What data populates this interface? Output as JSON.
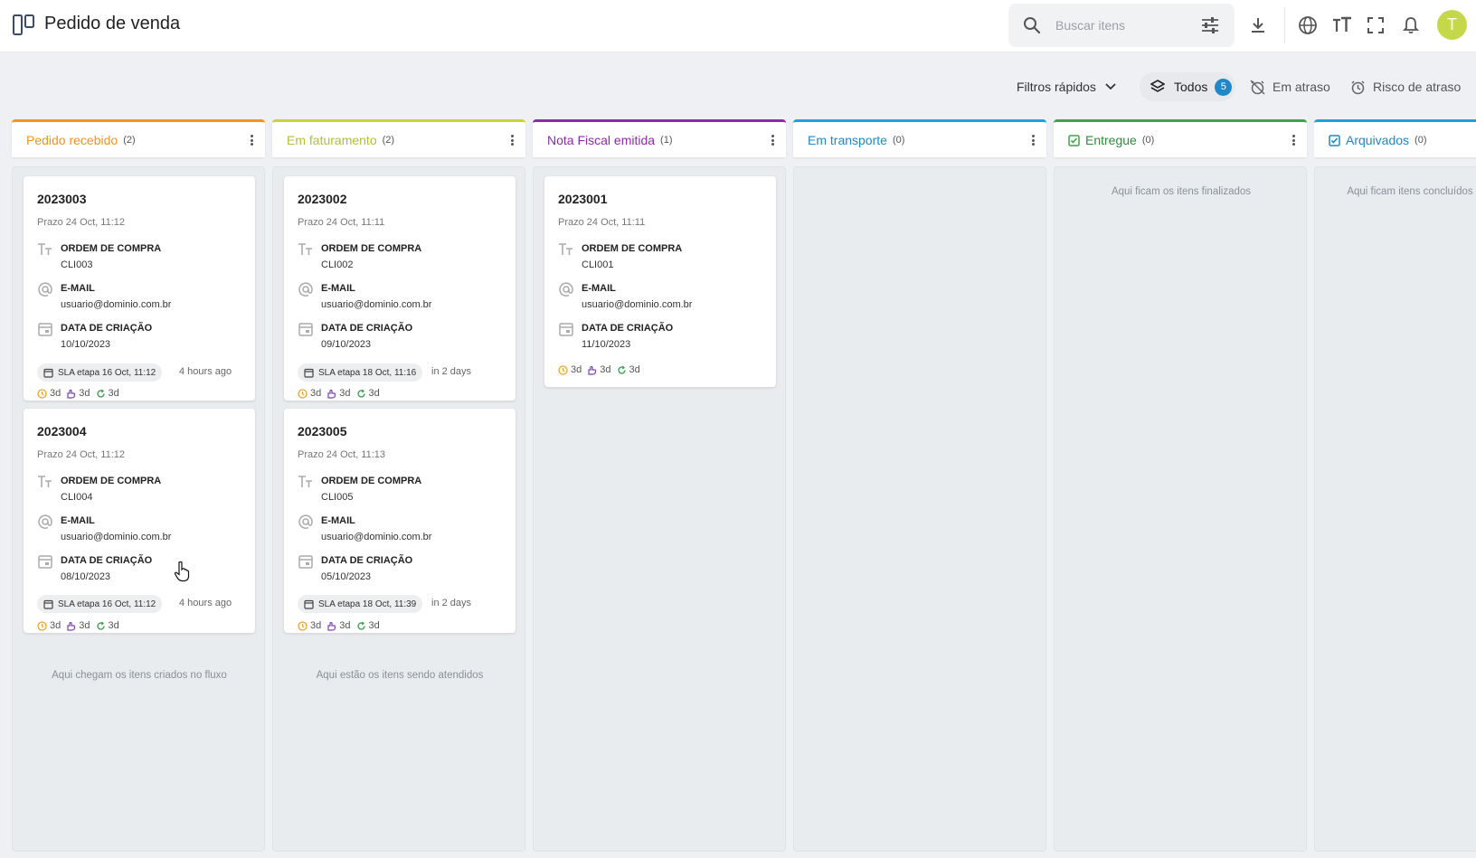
{
  "header": {
    "title": "Pedido de venda",
    "search_placeholder": "Buscar itens",
    "avatar_initial": "T",
    "icons": [
      "board-icon",
      "search-icon",
      "filter-sliders-icon",
      "download-icon",
      "globe-icon",
      "text-size-icon",
      "fullscreen-icon",
      "bell-icon"
    ]
  },
  "filters": {
    "quick_label": "Filtros rápidos",
    "all_label": "Todos",
    "all_count": "5",
    "late_label": "Em atraso",
    "risk_label": "Risco de atraso"
  },
  "colors": {
    "pedido": "#f5931f",
    "faturamento": "#c8d43c",
    "nota": "#8e2aa8",
    "transporte": "#1ea0dc",
    "entregue": "#3ea34a",
    "arquivados": "#1ea0dc"
  },
  "columns": [
    {
      "title": "Pedido recebido",
      "count": "(2)",
      "empty_text": "Aqui chegam os itens criados no fluxo",
      "cards": [
        {
          "id": "2023003",
          "prazo": "Prazo 24 Oct, 11:12",
          "f1_label": "ORDEM DE COMPRA",
          "f1_value": "CLI003",
          "f2_label": "E-MAIL",
          "f2_value": "usuario@dominio.com.br",
          "f3_label": "DATA DE CRIAÇÃO",
          "f3_value": "10/10/2023",
          "sla": "SLA etapa 16 Oct, 11:12",
          "ago": "4 hours ago",
          "m1": "3d",
          "m2": "3d",
          "m3": "3d"
        },
        {
          "id": "2023004",
          "prazo": "Prazo 24 Oct, 11:12",
          "f1_label": "ORDEM DE COMPRA",
          "f1_value": "CLI004",
          "f2_label": "E-MAIL",
          "f2_value": "usuario@dominio.com.br",
          "f3_label": "DATA DE CRIAÇÃO",
          "f3_value": "08/10/2023",
          "sla": "SLA etapa 16 Oct, 11:12",
          "ago": "4 hours ago",
          "m1": "3d",
          "m2": "3d",
          "m3": "3d"
        }
      ]
    },
    {
      "title": "Em faturamento",
      "count": "(2)",
      "empty_text": "Aqui estão os itens sendo atendidos",
      "cards": [
        {
          "id": "2023002",
          "prazo": "Prazo 24 Oct, 11:11",
          "f1_label": "ORDEM DE COMPRA",
          "f1_value": "CLI002",
          "f2_label": "E-MAIL",
          "f2_value": "usuario@dominio.com.br",
          "f3_label": "DATA DE CRIAÇÃO",
          "f3_value": "09/10/2023",
          "sla": "SLA etapa 18 Oct, 11:16",
          "ago": "in 2 days",
          "m1": "3d",
          "m2": "3d",
          "m3": "3d"
        },
        {
          "id": "2023005",
          "prazo": "Prazo 24 Oct, 11:13",
          "f1_label": "ORDEM DE COMPRA",
          "f1_value": "CLI005",
          "f2_label": "E-MAIL",
          "f2_value": "usuario@dominio.com.br",
          "f3_label": "DATA DE CRIAÇÃO",
          "f3_value": "05/10/2023",
          "sla": "SLA etapa 18 Oct, 11:39",
          "ago": "in 2 days",
          "m1": "3d",
          "m2": "3d",
          "m3": "3d"
        }
      ]
    },
    {
      "title": "Nota Fiscal emitida",
      "count": "(1)",
      "cards": [
        {
          "id": "2023001",
          "prazo": "Prazo 24 Oct, 11:11",
          "f1_label": "ORDEM DE COMPRA",
          "f1_value": "CLI001",
          "f2_label": "E-MAIL",
          "f2_value": "usuario@dominio.com.br",
          "f3_label": "DATA DE CRIAÇÃO",
          "f3_value": "11/10/2023",
          "m1": "3d",
          "m2": "3d",
          "m3": "3d"
        }
      ]
    },
    {
      "title": "Em transporte",
      "count": "(0)"
    },
    {
      "title": "Entregue",
      "count": "(0)",
      "empty_text": "Aqui ficam os itens finalizados"
    },
    {
      "title": "Arquivados",
      "count": "(0)",
      "empty_text": "Aqui ficam itens concluídos"
    }
  ]
}
